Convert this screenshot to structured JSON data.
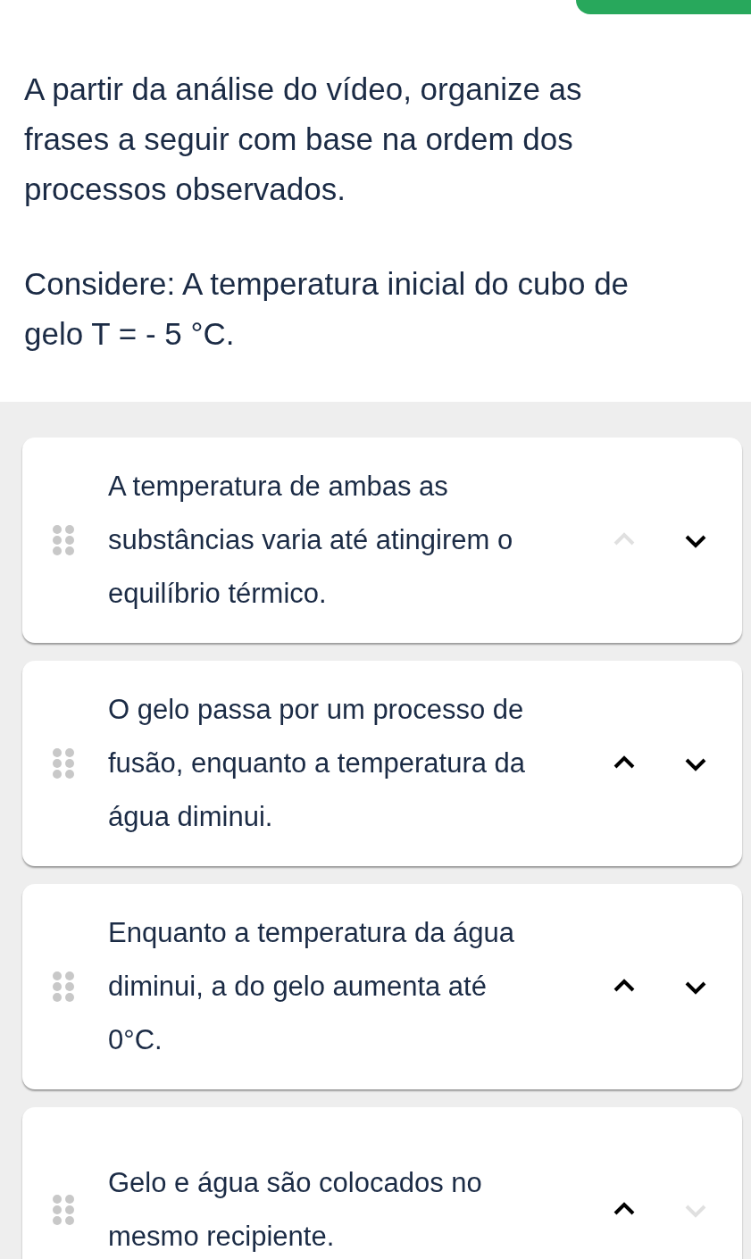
{
  "question": {
    "paragraphs": [
      "A partir da análise do vídeo, organize as frases a seguir com base na ordem dos processos observados.",
      "Considere: A temperatura inicial do cubo de gelo T = - 5 °C."
    ]
  },
  "items": [
    {
      "text": "A temperatura de ambas as substâncias varia até atingirem o equilíbrio térmico.",
      "up_disabled": true,
      "down_disabled": false
    },
    {
      "text": "O gelo passa por um processo de fusão, enquanto a temperatura da água diminui.",
      "up_disabled": false,
      "down_disabled": false
    },
    {
      "text": "Enquanto a temperatura da água diminui, a do gelo aumenta até 0°C.",
      "up_disabled": false,
      "down_disabled": false
    },
    {
      "text": "Gelo e água são colocados no mesmo recipiente.",
      "up_disabled": false,
      "down_disabled": true
    }
  ]
}
